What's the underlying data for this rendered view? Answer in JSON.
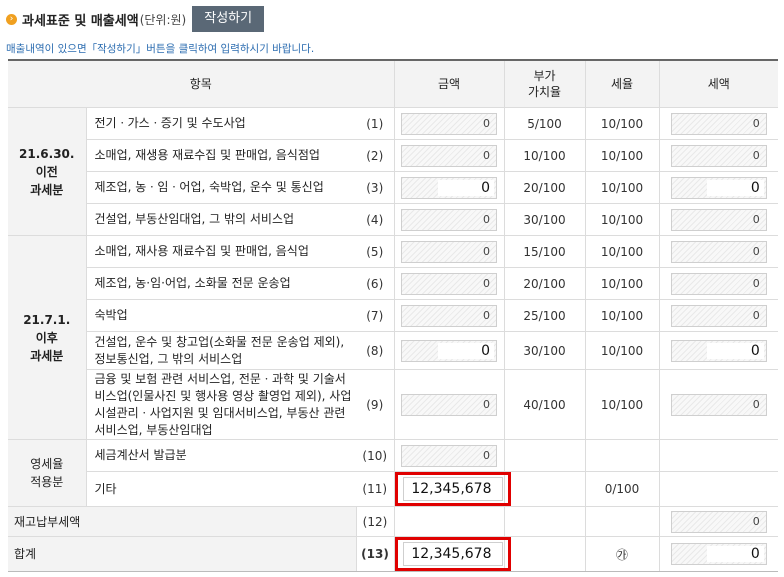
{
  "header": {
    "title": "과세표준 및 매출세액",
    "unit": "(단위:원)",
    "write_button": "작성하기",
    "note": "매출내역이 있으면「작성하기」버튼을 클릭하여 입력하시기 바랍니다."
  },
  "columns": {
    "item": "항목",
    "amount": "금액",
    "vat_rate": "부가\n가치율",
    "tax_rate": "세율",
    "tax": "세액"
  },
  "groups": {
    "before": "21.6.30.\n이전\n과세분",
    "after": "21.7.1.\n이후\n과세분",
    "zero": "영세율\n적용분"
  },
  "rows": [
    {
      "label": "전기ㆍ가스ㆍ증기 및 수도사업",
      "num": "(1)",
      "amount": "0",
      "vat_rate": "5/100",
      "tax_rate": "10/100",
      "tax": "0"
    },
    {
      "label": "소매업, 재생용 재료수집 및 판매업, 음식점업",
      "num": "(2)",
      "amount": "0",
      "vat_rate": "10/100",
      "tax_rate": "10/100",
      "tax": "0"
    },
    {
      "label": "제조업, 농ㆍ임ㆍ어업, 숙박업, 운수 및 통신업",
      "num": "(3)",
      "amount": "0",
      "vat_rate": "20/100",
      "tax_rate": "10/100",
      "tax": "0"
    },
    {
      "label": "건설업, 부동산임대업, 그 밖의 서비스업",
      "num": "(4)",
      "amount": "0",
      "vat_rate": "30/100",
      "tax_rate": "10/100",
      "tax": "0"
    },
    {
      "label": "소매업, 재사용 재료수집 및 판매업, 음식업",
      "num": "(5)",
      "amount": "0",
      "vat_rate": "15/100",
      "tax_rate": "10/100",
      "tax": "0"
    },
    {
      "label": "제조업, 농·임·어업, 소화물 전문 운송업",
      "num": "(6)",
      "amount": "0",
      "vat_rate": "20/100",
      "tax_rate": "10/100",
      "tax": "0"
    },
    {
      "label": "숙박업",
      "num": "(7)",
      "amount": "0",
      "vat_rate": "25/100",
      "tax_rate": "10/100",
      "tax": "0"
    },
    {
      "label": "건설업, 운수 및 창고업(소화물 전문 운송업 제외), 정보통신업, 그 밖의 서비스업",
      "num": "(8)",
      "amount": "0",
      "vat_rate": "30/100",
      "tax_rate": "10/100",
      "tax": "0"
    },
    {
      "label": "금융 및 보험 관련 서비스업, 전문ㆍ과학 및 기술서비스업(인물사진 및 행사용 영상 촬영업 제외), 사업시설관리ㆍ사업지원 및 임대서비스업, 부동산 관련 서비스업, 부동산임대업",
      "num": "(9)",
      "amount": "0",
      "vat_rate": "40/100",
      "tax_rate": "10/100",
      "tax": "0"
    },
    {
      "label": "세금계산서 발급분",
      "num": "(10)",
      "amount": "0"
    },
    {
      "label": "기타",
      "num": "(11)",
      "amount": "12,345,678",
      "tax_rate": "0/100"
    }
  ],
  "reserve": {
    "label": "재고납부세액",
    "num": "(12)",
    "tax": "0"
  },
  "total": {
    "label": "합계",
    "num": "(13)",
    "amount": "12,345,678",
    "symbol": "㉮",
    "tax": "0"
  }
}
